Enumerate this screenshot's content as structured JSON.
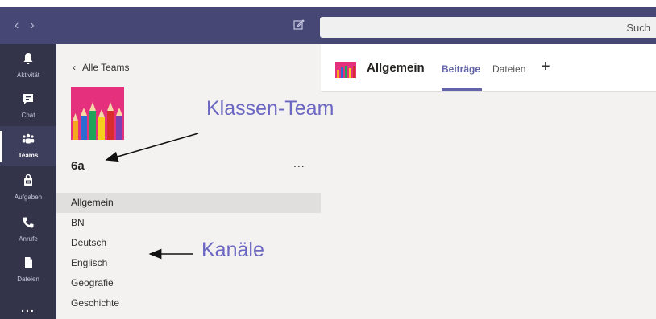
{
  "topbar": {
    "search_placeholder": "Such"
  },
  "rail": {
    "items": [
      {
        "label": "Aktivität",
        "icon": "bell-icon"
      },
      {
        "label": "Chat",
        "icon": "chat-icon"
      },
      {
        "label": "Teams",
        "icon": "teams-icon"
      },
      {
        "label": "Aufgaben",
        "icon": "assignments-icon"
      },
      {
        "label": "Anrufe",
        "icon": "phone-icon"
      },
      {
        "label": "Dateien",
        "icon": "file-icon"
      }
    ],
    "more": "..."
  },
  "panel": {
    "back_label": "Alle Teams",
    "team_name": "6a",
    "more": "...",
    "channels": [
      "Allgemein",
      "BN",
      "Deutsch",
      "Englisch",
      "Geografie",
      "Geschichte"
    ],
    "selected_channel": "Allgemein"
  },
  "main": {
    "title": "Allgemein",
    "tabs": [
      {
        "label": "Beiträge",
        "active": true
      },
      {
        "label": "Dateien",
        "active": false
      }
    ],
    "add_tab": "+"
  },
  "annotations": {
    "team": "Klassen-Team",
    "channels": "Kanäle"
  },
  "colors": {
    "accent": "#6264a7",
    "topbar": "#464775",
    "rail": "#33344a",
    "annotation": "#6b66c2"
  }
}
